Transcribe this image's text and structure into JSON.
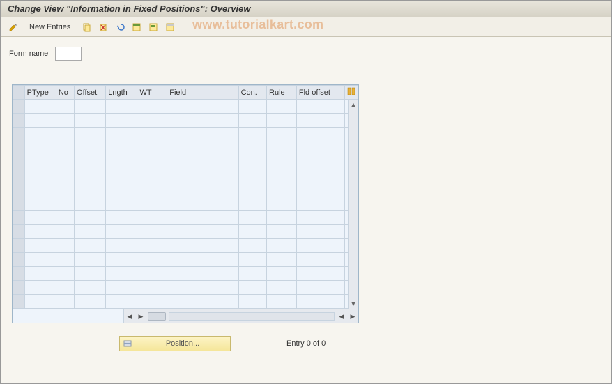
{
  "header": {
    "title": "Change View \"Information in Fixed Positions\": Overview"
  },
  "toolbar": {
    "new_entries_label": "New Entries",
    "icons": {
      "pencil": "pencil-icon",
      "copy": "copy-icon",
      "delete": "delete-icon",
      "undo": "undo-icon",
      "select_all": "select-all-icon",
      "select_block": "select-block-icon",
      "deselect": "deselect-icon"
    }
  },
  "watermark": "www.tutorialkart.com",
  "form": {
    "label": "Form name",
    "value": ""
  },
  "grid": {
    "columns": [
      "PType",
      "No",
      "Offset",
      "Lngth",
      "WT",
      "Field",
      "Con.",
      "Rule",
      "Fld offset"
    ],
    "rows": 15
  },
  "footer": {
    "position_label": "Position...",
    "entry_text": "Entry 0 of 0"
  }
}
